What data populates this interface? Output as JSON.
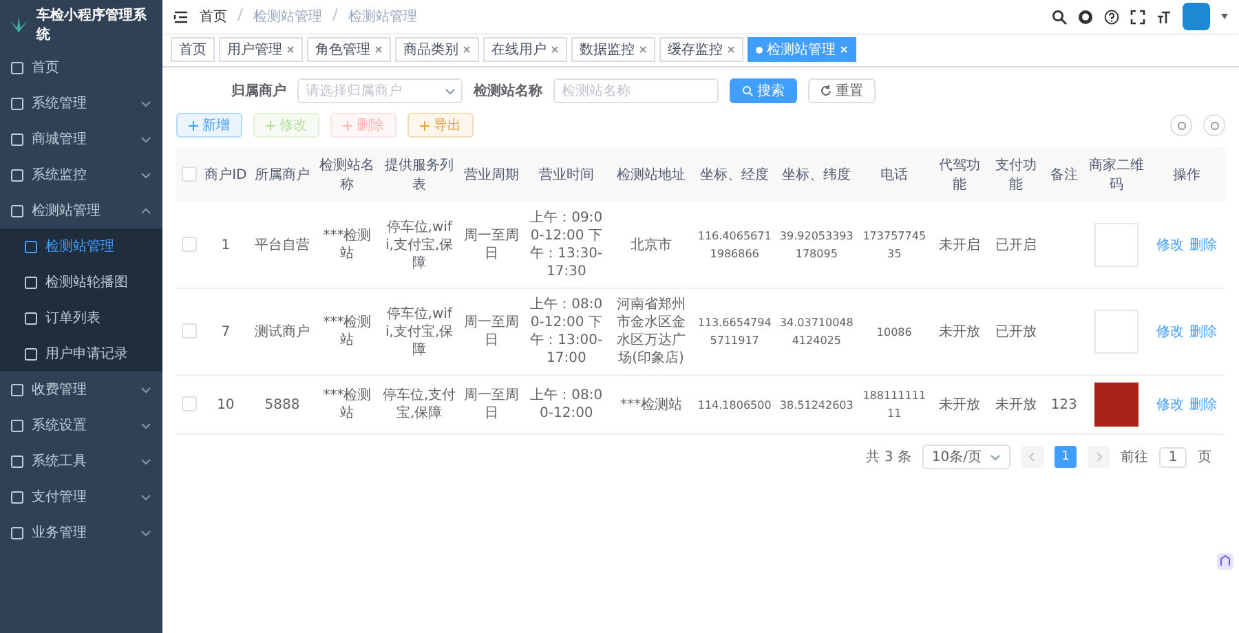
{
  "sidebar": {
    "title": "车检小程序管理系统",
    "items": [
      {
        "label": "首页"
      },
      {
        "label": "系统管理",
        "expanded": false
      },
      {
        "label": "商城管理",
        "expanded": false
      },
      {
        "label": "系统监控",
        "expanded": false
      },
      {
        "label": "检测站管理",
        "expanded": true,
        "children": [
          {
            "label": "检测站管理",
            "selected": true
          },
          {
            "label": "检测站轮播图",
            "selected": false
          },
          {
            "label": "订单列表",
            "selected": false
          },
          {
            "label": "用户申请记录",
            "selected": false
          }
        ]
      },
      {
        "label": "收费管理",
        "expanded": false
      },
      {
        "label": "系统设置",
        "expanded": false
      },
      {
        "label": "系统工具",
        "expanded": false
      },
      {
        "label": "支付管理",
        "expanded": false
      },
      {
        "label": "业务管理",
        "expanded": false
      }
    ]
  },
  "breadcrumb": [
    "首页",
    "检测站管理",
    "检测站管理"
  ],
  "tabs": [
    {
      "label": "首页",
      "selected": false,
      "closable": false
    },
    {
      "label": "用户管理",
      "selected": false,
      "closable": true
    },
    {
      "label": "角色管理",
      "selected": false,
      "closable": true
    },
    {
      "label": "商品类别",
      "selected": false,
      "closable": true
    },
    {
      "label": "在线用户",
      "selected": false,
      "closable": true
    },
    {
      "label": "数据监控",
      "selected": false,
      "closable": true
    },
    {
      "label": "缓存监控",
      "selected": false,
      "closable": true
    },
    {
      "label": "检测站管理",
      "selected": true,
      "closable": true
    }
  ],
  "search": {
    "fields": [
      {
        "label": "归属商户",
        "kind": "select",
        "placeholder": "请选择归属商户"
      },
      {
        "label": "检测站名称",
        "kind": "input",
        "placeholder": "检测站名称"
      }
    ],
    "buttons": [
      {
        "label": "搜索",
        "kind": "primary"
      },
      {
        "label": "重置",
        "kind": "plain"
      }
    ]
  },
  "toolbar": [
    {
      "label": "新增",
      "kind": "primary",
      "disabled": false
    },
    {
      "label": "修改",
      "kind": "success",
      "disabled": true
    },
    {
      "label": "删除",
      "kind": "danger",
      "disabled": true
    },
    {
      "label": "导出",
      "kind": "warning",
      "disabled": false
    }
  ],
  "table": {
    "all_checked": false,
    "columns": [
      "商户ID",
      "所属商户",
      "检测站名称",
      "提供服务列表",
      "营业周期",
      "营业时间",
      "检测站地址",
      "坐标、经度",
      "坐标、纬度",
      "电话",
      "代驾功能",
      "支付功能",
      "备注",
      "商家二维码",
      "操作"
    ],
    "rows": [
      {
        "checked": false,
        "cells": [
          "1",
          "平台自营",
          "***检测站",
          "停车位,wifi,支付宝,保障",
          "周一至周日",
          "上午：09:00-12:00 下午：13:30-17:30",
          "北京市",
          "116.40656711986866",
          "39.92053393178095",
          "17375774535",
          "未开启",
          "已开启",
          ""
        ],
        "qr": {
          "kind": "empty"
        },
        "actions": [
          "修改",
          "删除"
        ]
      },
      {
        "checked": false,
        "cells": [
          "7",
          "测试商户",
          "***检测站",
          "停车位,wifi,支付宝,保障",
          "周一至周日",
          "上午：08:00-12:00 下午：13:00-17:00",
          "河南省郑州市金水区金水区万达广场(印象店)",
          "113.66547945711917",
          "34.037100484124025",
          "10086",
          "未开放",
          "已开放",
          ""
        ],
        "qr": {
          "kind": "empty"
        },
        "actions": [
          "修改",
          "删除"
        ]
      },
      {
        "checked": false,
        "cells": [
          "10",
          "5888",
          "***检测站",
          "停车位,支付宝,保障",
          "周一至周日",
          "上午：08:00-12:00",
          "***检测站",
          "114.1806500",
          "38.51242603",
          "18811111111",
          "未开放",
          "未开放",
          "123"
        ],
        "qr": {
          "kind": "image"
        },
        "actions": [
          "修改",
          "删除"
        ]
      }
    ]
  },
  "pagination": {
    "total": "共 3 条",
    "page_size": "10条/页",
    "pages": [
      {
        "label": "1",
        "selected": true
      }
    ],
    "goto_label": "前往",
    "goto_value": "1",
    "goto_unit": "页"
  }
}
